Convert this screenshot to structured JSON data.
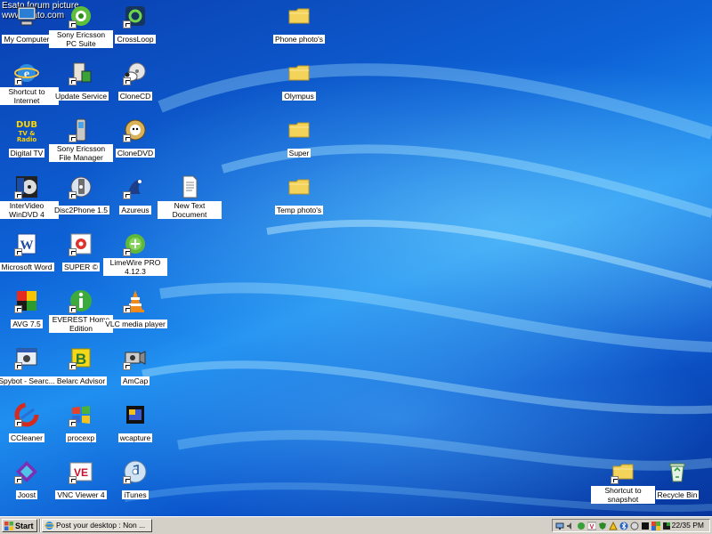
{
  "watermark": {
    "line1": "Esato forum picture",
    "line2": "www.esato.com"
  },
  "desktop_icons": {
    "my_computer": "My Computer",
    "sony_pc_suite": "Sony Ericsson PC Suite",
    "crossloop": "CrossLoop",
    "phone_photos": "Phone photo's",
    "shortcut_internet": "Shortcut to Internet",
    "update_service": "Update Service",
    "clonecd": "CloneCD",
    "olympus": "Olympus",
    "digital_tv": "Digital TV",
    "sony_file_manager": "Sony Ericsson File Manager",
    "clonedvd": "CloneDVD",
    "super_folder": "Super",
    "interVideo": "InterVideo WinDVD 4",
    "disc2phone": "Disc2Phone 1.5",
    "azureus": "Azureus",
    "new_text_doc": "New Text Document",
    "temp_photos": "Temp photo's",
    "word": "Microsoft Word",
    "super_app": "SUPER ©",
    "limewire": "LimeWire PRO 4.12.3",
    "avg": "AVG 7.5",
    "everest": "EVEREST Home Edition",
    "vlc": "VLC media player",
    "spybot": "Spybot - Searc...",
    "belarc": "Belarc Advisor",
    "amcap": "AmCap",
    "ccleaner": "CCleaner",
    "procexp": "procexp",
    "wcapture": "wcapture",
    "joost": "Joost",
    "vnc": "VNC Viewer 4",
    "itunes": "iTunes",
    "shortcut_snapshot": "Shortcut to snapshot",
    "recycle_bin": "Recycle Bin"
  },
  "taskbar": {
    "start_label": "Start",
    "task_window_title": "Post your desktop : Non ...",
    "clock": "22/35 PM",
    "tray_icons": [
      "network-icon",
      "speaker-icon",
      "sync-icon",
      "vnc-tray-icon",
      "shield-icon",
      "warning-icon",
      "bluetooth-icon",
      "update-icon",
      "msn-icon",
      "display-icon",
      "avg-tray-icon"
    ]
  },
  "colors": {
    "desktop_blue": "#0d62d6",
    "taskbar_gray": "#d4d0c8",
    "folder_yellow": "#f3d35a"
  }
}
